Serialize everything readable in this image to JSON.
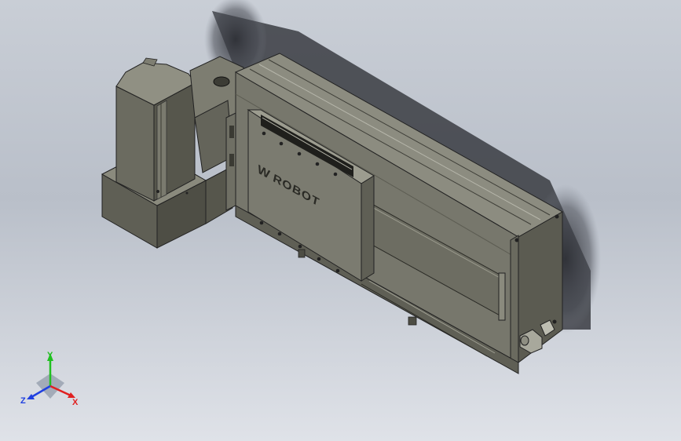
{
  "viewport": {
    "background_top": "#c9ced6",
    "background_bottom": "#dfe2e8"
  },
  "model": {
    "logo_text": "ROBOT",
    "body_color": "#77776c",
    "shadow_color": "#2f3137"
  },
  "triad": {
    "x_label": "X",
    "y_label": "Y",
    "z_label": "Z",
    "x_color": "#e02020",
    "y_color": "#20c020",
    "z_color": "#2040e0"
  }
}
